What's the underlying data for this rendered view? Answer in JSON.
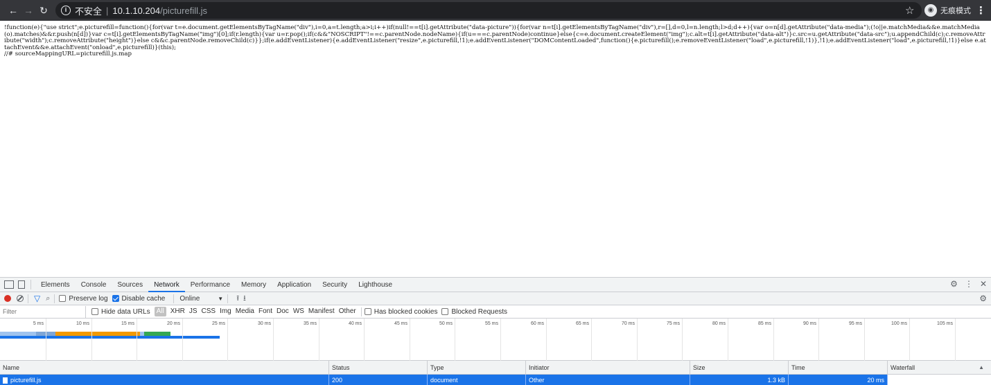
{
  "browser": {
    "security_label": "不安全",
    "url_host": "10.1.10.204",
    "url_path": "/picturefill.js",
    "incognito_label": "无痕模式"
  },
  "page": {
    "source_text": "!function(e){\"use strict\";e.picturefill=function(){for(var t=e.document.getElementsByTagName(\"div\"),i=0,a=t.length;a>i;i++)if(null!==t[i].getAttribute(\"data-picture\")){for(var n=t[i].getElementsByTagName(\"div\"),r=[],d=0,l=n.length;l>d;d++){var o=n[d].getAttribute(\"data-media\");(!o||e.matchMedia&&e.matchMedia(o).matches)&&r.push(n[d])}var c=t[i].getElementsByTagName(\"img\")[0];if(r.length){var u=r.pop();if(c&&\"NOSCRIPT\"!==c.parentNode.nodeName){if(u===c.parentNode)continue}else{c=e.document.createElement(\"img\");c.alt=t[i].getAttribute(\"data-alt\")}c.src=u.getAttribute(\"data-src\");u.appendChild(c);c.removeAttribute(\"width\");c.removeAttribute(\"height\")}else c&&c.parentNode.removeChild(c)}};if(e.addEventListener){e.addEventListener(\"resize\",e.picturefill,!1);e.addEventListener(\"DOMContentLoaded\",function(){e.picturefill();e.removeEventListener(\"load\",e.picturefill,!1)},!1);e.addEventListener(\"load\",e.picturefill,!1)}else e.attachEvent&&e.attachEvent(\"onload\",e.picturefill)}(this);\n//# sourceMappingURL=picturefill.js.map"
  },
  "devtools": {
    "tabs": [
      "Elements",
      "Console",
      "Sources",
      "Network",
      "Performance",
      "Memory",
      "Application",
      "Security",
      "Lighthouse"
    ],
    "active_tab": "Network",
    "toolbar": {
      "preserve_log": "Preserve log",
      "disable_cache": "Disable cache",
      "throttling": "Online"
    },
    "filter": {
      "placeholder": "Filter",
      "hide_data_urls": "Hide data URLs",
      "types": [
        "All",
        "XHR",
        "JS",
        "CSS",
        "Img",
        "Media",
        "Font",
        "Doc",
        "WS",
        "Manifest",
        "Other"
      ],
      "has_blocked_cookies": "Has blocked cookies",
      "blocked_requests": "Blocked Requests"
    },
    "timeline_ticks": [
      "5 ms",
      "10 ms",
      "15 ms",
      "20 ms",
      "25 ms",
      "30 ms",
      "35 ms",
      "40 ms",
      "45 ms",
      "50 ms",
      "55 ms",
      "60 ms",
      "65 ms",
      "70 ms",
      "75 ms",
      "80 ms",
      "85 ms",
      "90 ms",
      "95 ms",
      "100 ms",
      "105 ms"
    ],
    "columns": [
      "Name",
      "Status",
      "Type",
      "Initiator",
      "Size",
      "Time",
      "Waterfall"
    ],
    "rows": [
      {
        "name": "picturefill.js",
        "status": "200",
        "type": "document",
        "initiator": "Other",
        "size": "1.3 kB",
        "time": "20 ms"
      }
    ],
    "colors": {
      "accent": "#1a73e8",
      "waiting": "#f29900",
      "download": "#34a853",
      "receive": "#1a73e8"
    }
  }
}
